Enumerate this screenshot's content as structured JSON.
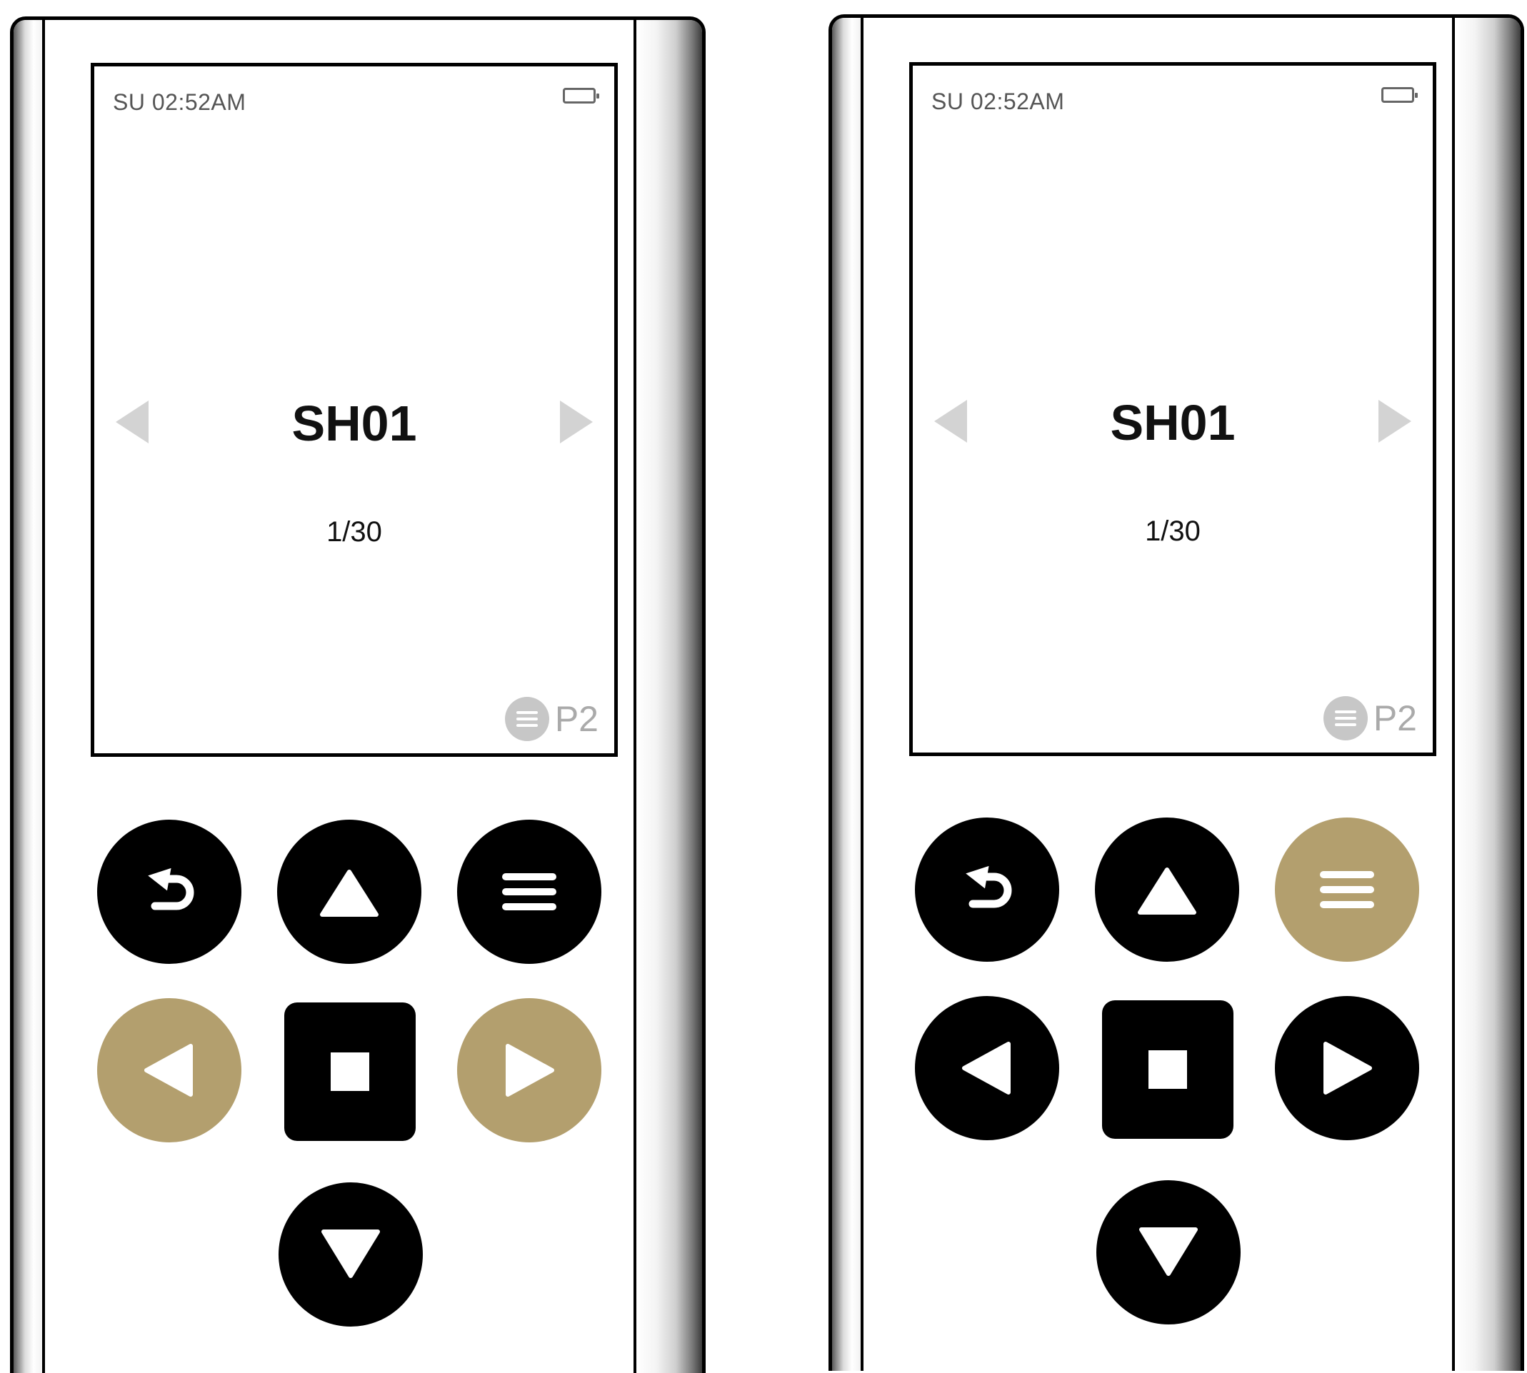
{
  "accent_color": "#b39f6e",
  "devices": [
    {
      "status": {
        "time": "SU 02:52AM",
        "battery_icon": "battery-icon"
      },
      "screen": {
        "title": "SH01",
        "counter": "1/30",
        "page": "P2"
      },
      "buttons": {
        "back": {
          "icon": "back-arrow-icon",
          "active": false
        },
        "up": {
          "icon": "triangle-up-icon",
          "active": false
        },
        "menu": {
          "icon": "menu-icon",
          "active": false
        },
        "left": {
          "icon": "triangle-left-icon",
          "active": true
        },
        "stop": {
          "icon": "stop-icon",
          "active": false
        },
        "right": {
          "icon": "triangle-right-icon",
          "active": true
        },
        "down": {
          "icon": "triangle-down-icon",
          "active": false
        }
      }
    },
    {
      "status": {
        "time": "SU 02:52AM",
        "battery_icon": "battery-icon"
      },
      "screen": {
        "title": "SH01",
        "counter": "1/30",
        "page": "P2"
      },
      "buttons": {
        "back": {
          "icon": "back-arrow-icon",
          "active": false
        },
        "up": {
          "icon": "triangle-up-icon",
          "active": false
        },
        "menu": {
          "icon": "menu-icon",
          "active": true
        },
        "left": {
          "icon": "triangle-left-icon",
          "active": false
        },
        "stop": {
          "icon": "stop-icon",
          "active": false
        },
        "right": {
          "icon": "triangle-right-icon",
          "active": false
        },
        "down": {
          "icon": "triangle-down-icon",
          "active": false
        }
      }
    }
  ]
}
